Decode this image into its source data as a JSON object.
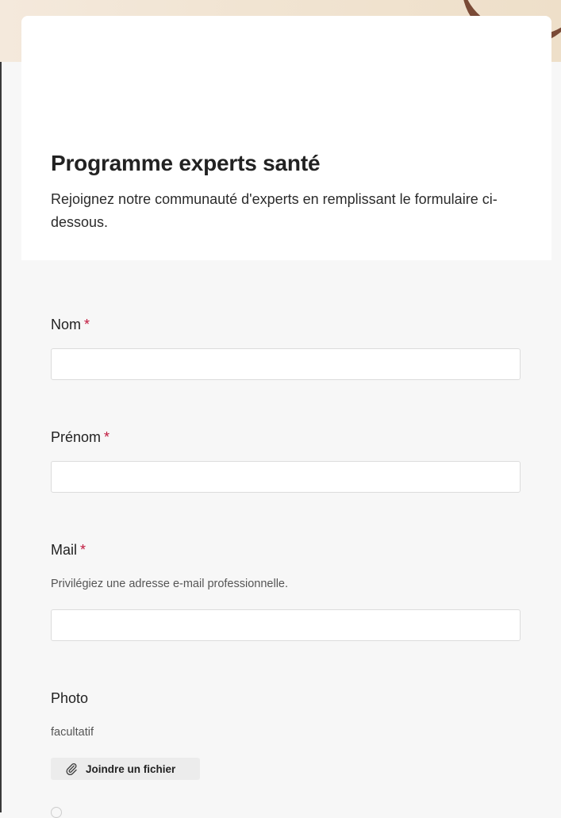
{
  "form": {
    "title": "Programme experts santé",
    "description": "Rejoignez notre communauté d'experts en remplissant le formulaire ci-dessous."
  },
  "fields": {
    "nom": {
      "label": "Nom",
      "required_mark": "*",
      "value": ""
    },
    "prenom": {
      "label": "Prénom",
      "required_mark": "*",
      "value": ""
    },
    "mail": {
      "label": "Mail",
      "required_mark": "*",
      "help": "Privilégiez une adresse e-mail professionnelle.",
      "value": ""
    },
    "photo": {
      "label": "Photo",
      "help": "facultatif",
      "button_label": "Joindre un fichier"
    }
  },
  "colors": {
    "required": "#c0183d",
    "page_background": "#f7f7f7",
    "card_background": "#ffffff"
  },
  "icons": {
    "attach": "paperclip-icon"
  }
}
